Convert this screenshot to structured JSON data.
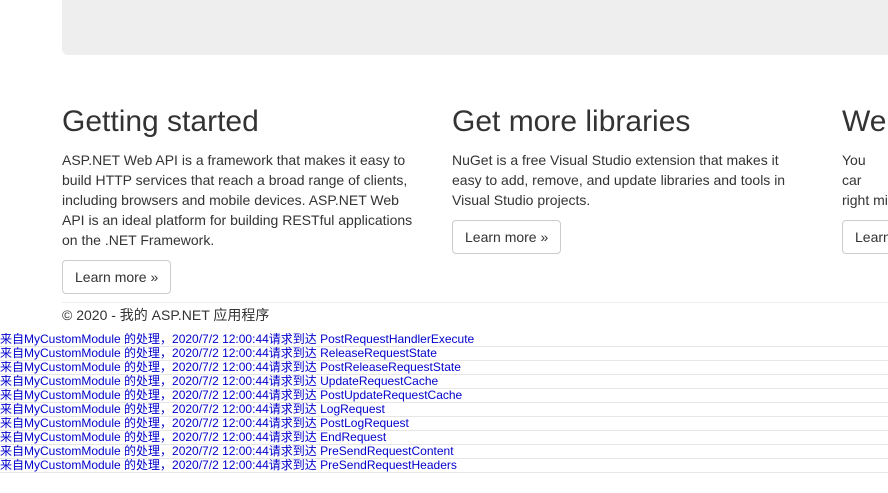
{
  "columns": [
    {
      "title": "Getting started",
      "text": "ASP.NET Web API is a framework that makes it easy to build HTTP services that reach a broad range of clients, including browsers and mobile devices. ASP.NET Web API is an ideal platform for building RESTful applications on the .NET Framework.",
      "button": "Learn more »"
    },
    {
      "title": "Get more libraries",
      "text": "NuGet is a free Visual Studio extension that makes it easy to add, remove, and update libraries and tools in Visual Studio projects.",
      "button": "Learn more »"
    },
    {
      "title": "We",
      "text": "You car right mi",
      "button": "Learn"
    }
  ],
  "footer": {
    "text": "© 2020 - 我的 ASP.NET 应用程序"
  },
  "log": [
    "来自MyCustomModule 的处理，2020/7/2 12:00:44请求到达 PostRequestHandlerExecute",
    "来自MyCustomModule 的处理，2020/7/2 12:00:44请求到达 ReleaseRequestState",
    "来自MyCustomModule 的处理，2020/7/2 12:00:44请求到达 PostReleaseRequestState",
    "来自MyCustomModule 的处理，2020/7/2 12:00:44请求到达 UpdateRequestCache",
    "来自MyCustomModule 的处理，2020/7/2 12:00:44请求到达 PostUpdateRequestCache",
    "来自MyCustomModule 的处理，2020/7/2 12:00:44请求到达 LogRequest",
    "来自MyCustomModule 的处理，2020/7/2 12:00:44请求到达 PostLogRequest",
    "来自MyCustomModule 的处理，2020/7/2 12:00:44请求到达 EndRequest",
    "来自MyCustomModule 的处理，2020/7/2 12:00:44请求到达 PreSendRequestContent",
    "来自MyCustomModule 的处理，2020/7/2 12:00:44请求到达 PreSendRequestHeaders"
  ]
}
